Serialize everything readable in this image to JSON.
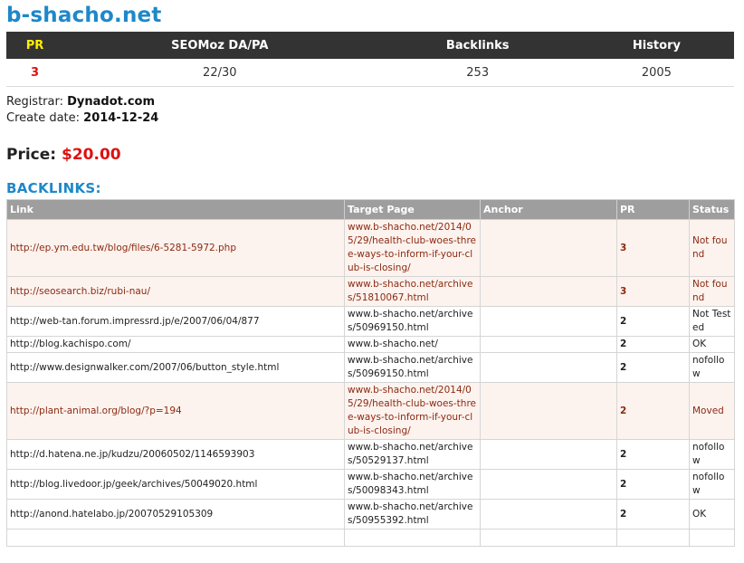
{
  "site": {
    "title": "b-shacho.net"
  },
  "summary": {
    "headers": [
      "PR",
      "SEOMoz DA/PA",
      "Backlinks",
      "History"
    ],
    "values": [
      "3",
      "22/30",
      "253",
      "2005"
    ]
  },
  "details": {
    "registrar_label": "Registrar:",
    "registrar": "Dynadot.com",
    "create_label": "Create date:",
    "create_date": "2014-12-24"
  },
  "price": {
    "label": "Price:",
    "amount": "$20.00"
  },
  "backlinks": {
    "title": "BACKLINKS:",
    "columns": [
      "Link",
      "Target Page",
      "Anchor",
      "PR",
      "Status"
    ],
    "rows": [
      {
        "link": "http://ep.ym.edu.tw/blog/files/6-5281-5972.php",
        "target": "www.b-shacho.net/2014/05/29/health-club-woes-three-ways-to-inform-if-your-club-is-closing/",
        "anchor": "",
        "pr": "3",
        "status": "Not found",
        "highlight": true
      },
      {
        "link": "http://seosearch.biz/rubi-nau/",
        "target": "www.b-shacho.net/archives/51810067.html",
        "anchor": "",
        "pr": "3",
        "status": "Not found",
        "highlight": true
      },
      {
        "link": "http://web-tan.forum.impressrd.jp/e/2007/06/04/877",
        "target": "www.b-shacho.net/archives/50969150.html",
        "anchor": "",
        "pr": "2",
        "status": "Not Tested",
        "highlight": false
      },
      {
        "link": "http://blog.kachispo.com/",
        "target": "www.b-shacho.net/",
        "anchor": "",
        "pr": "2",
        "status": "OK",
        "highlight": false
      },
      {
        "link": "http://www.designwalker.com/2007/06/button_style.html",
        "target": "www.b-shacho.net/archives/50969150.html",
        "anchor": "",
        "pr": "2",
        "status": "nofollow",
        "highlight": false
      },
      {
        "link": "http://plant-animal.org/blog/?p=194",
        "target": "www.b-shacho.net/2014/05/29/health-club-woes-three-ways-to-inform-if-your-club-is-closing/",
        "anchor": "",
        "pr": "2",
        "status": "Moved",
        "highlight": true
      },
      {
        "link": "http://d.hatena.ne.jp/kudzu/20060502/1146593903",
        "target": "www.b-shacho.net/archives/50529137.html",
        "anchor": "",
        "pr": "2",
        "status": "nofollow",
        "highlight": false
      },
      {
        "link": "http://blog.livedoor.jp/geek/archives/50049020.html",
        "target": "www.b-shacho.net/archives/50098343.html",
        "anchor": "",
        "pr": "2",
        "status": "nofollow",
        "highlight": false
      },
      {
        "link": "http://anond.hatelabo.jp/20070529105309",
        "target": "www.b-shacho.net/archives/50955392.html",
        "anchor": "",
        "pr": "2",
        "status": "OK",
        "highlight": false
      },
      {
        "link": "",
        "target": "",
        "anchor": "",
        "pr": "",
        "status": "",
        "highlight": false
      }
    ]
  },
  "colors": {
    "title_blue": "#1e88c9",
    "header_dark": "#333333",
    "pr_yellow": "#ffee00",
    "accent_red": "#dd1111",
    "table_header_gray": "#9e9e9e",
    "highlight_row_bg": "#fdf3ee",
    "highlight_row_text": "#8b2a12"
  }
}
